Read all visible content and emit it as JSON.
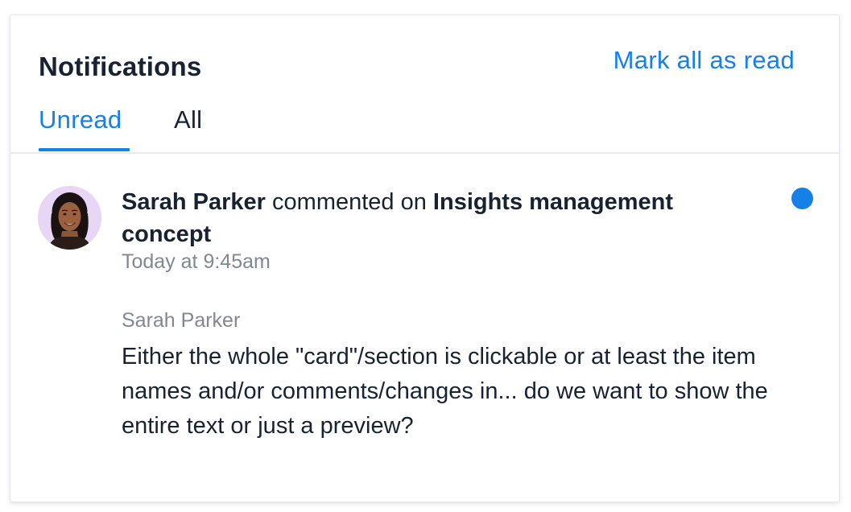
{
  "header": {
    "title": "Notifications",
    "mark_all_label": "Mark all as read"
  },
  "tabs": [
    {
      "label": "Unread",
      "active": true
    },
    {
      "label": "All",
      "active": false
    }
  ],
  "notification": {
    "actor": "Sarah Parker",
    "action": "commented on",
    "target": "Insights management concept",
    "timestamp": "Today at 9:45am",
    "comment_author": "Sarah Parker",
    "comment_text": "Either the whole \"card\"/section is clickable or at least the item names and/or comments/changes in... do we want to show the entire text or just a preview?",
    "unread": true,
    "avatar_icon": "user-avatar-photo"
  },
  "colors": {
    "accent": "#1580e8",
    "text_primary": "#172333",
    "text_secondary": "#7f8894",
    "avatar_bg": "#e7d6f6"
  }
}
